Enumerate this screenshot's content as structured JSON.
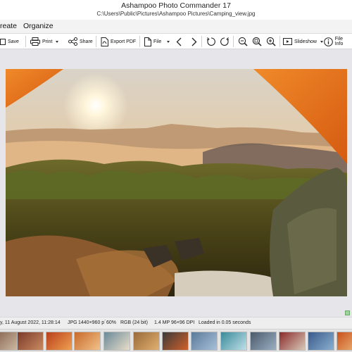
{
  "window": {
    "app_title": "Ashampoo Photo Commander 17",
    "file_path": "C:\\Users\\Public\\Pictures\\Ashampoo Pictures\\Camping_view.jpg"
  },
  "menu": [
    "reate",
    "Organize"
  ],
  "toolbar": {
    "save": "Save",
    "print": "Print",
    "share": "Share",
    "export_pdf": "Export PDF",
    "file": "File",
    "slideshow": "Slideshow",
    "file_info": "File Info"
  },
  "status": {
    "date": "y, 11 August 2022, 11:28:14",
    "format": "JPG",
    "dimensions": "1440×960 p´",
    "zoom": "60%",
    "color": "RGB (24 bit)",
    "megapixels": "1.4 MP",
    "dpi": "96×96 DPI",
    "load_time": "Loaded in 0.05 seconds"
  },
  "filmstrip": {
    "thumbnails": [
      {
        "colors": [
          "#8a6a55",
          "#d9c6b0"
        ]
      },
      {
        "colors": [
          "#7a3a2a",
          "#c98a60"
        ]
      },
      {
        "colors": [
          "#b8401c",
          "#f0a050"
        ]
      },
      {
        "colors": [
          "#c86a2a",
          "#f2c28a"
        ]
      },
      {
        "colors": [
          "#6a8a9a",
          "#e8ddc8"
        ]
      },
      {
        "colors": [
          "#9a6a3a",
          "#e0b070"
        ]
      },
      {
        "colors": [
          "#3a3a3a",
          "#d0602a"
        ]
      },
      {
        "colors": [
          "#5a7a9a",
          "#a8c0d8"
        ]
      },
      {
        "colors": [
          "#3a8a9a",
          "#bfe0e8"
        ]
      },
      {
        "colors": [
          "#4a5a6a",
          "#9ab0c4"
        ]
      },
      {
        "colors": [
          "#8a2a2a",
          "#d8c8b8"
        ]
      },
      {
        "colors": [
          "#3a5a8a",
          "#8ab0d0"
        ]
      },
      {
        "colors": [
          "#c8501c",
          "#f0c080"
        ]
      }
    ]
  }
}
